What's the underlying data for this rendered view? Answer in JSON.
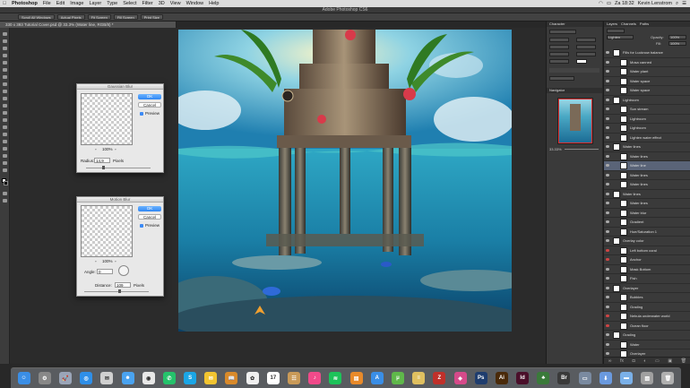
{
  "menubar": {
    "app": "Photoshop",
    "items": [
      "File",
      "Edit",
      "Image",
      "Layer",
      "Type",
      "Select",
      "Filter",
      "3D",
      "View",
      "Window",
      "Help"
    ],
    "clock": "Za 18:32",
    "user": "Kevin Lenstrom"
  },
  "window": {
    "title": "Adobe Photoshop CS6"
  },
  "options": {
    "buttons": [
      "Scroll All Windows",
      "Actual Pixels",
      "Fit Screen",
      "Fill Screen",
      "Print Size"
    ]
  },
  "document": {
    "tab": "330 x 393 Tutorial Cover.psd @ 33.3% (Water line, RGB/8) *"
  },
  "gaussian": {
    "title": "Gaussian Blur",
    "ok": "OK",
    "cancel": "Cancel",
    "preview": "Preview",
    "zoom": "100%",
    "radius_label": "Radius:",
    "radius_value": "14,9",
    "radius_unit": "Pixels"
  },
  "motion": {
    "title": "Motion Blur",
    "ok": "OK",
    "cancel": "Cancel",
    "preview": "Preview",
    "zoom": "100%",
    "angle_label": "Angle:",
    "angle_value": "0",
    "distance_label": "Distance:",
    "distance_value": "109",
    "distance_unit": "Pixels"
  },
  "dock_right": {
    "character_tab": "Character",
    "navigator_tab": "Navigator",
    "nav_zoom": "33.33%"
  },
  "layers_panel": {
    "tabs": [
      "Layers",
      "Channels",
      "Paths"
    ],
    "blend": "Lighten",
    "opacity_label": "Opacity:",
    "opacity": "100%",
    "fill_label": "Fill:",
    "fill": "100%",
    "layers": [
      {
        "name": "Fills for Lucknow balance",
        "sel": false,
        "red": false
      },
      {
        "name": "Mosa canned",
        "sel": false,
        "red": false
      },
      {
        "name": "Water plant",
        "sel": false,
        "red": false
      },
      {
        "name": "Water space",
        "sel": false,
        "red": false
      },
      {
        "name": "Water space",
        "sel": false,
        "red": false
      },
      {
        "name": "Lightroom",
        "sel": false,
        "red": false
      },
      {
        "name": "Sun stream",
        "sel": false,
        "red": false
      },
      {
        "name": "Lightroom",
        "sel": false,
        "red": false
      },
      {
        "name": "Lightroom",
        "sel": false,
        "red": false
      },
      {
        "name": "Lighten water effect",
        "sel": false,
        "red": false
      },
      {
        "name": "Water lines",
        "sel": false,
        "red": false
      },
      {
        "name": "Water lines",
        "sel": false,
        "red": false
      },
      {
        "name": "Water line",
        "sel": true,
        "red": false
      },
      {
        "name": "Water lines",
        "sel": false,
        "red": false
      },
      {
        "name": "Water lines",
        "sel": false,
        "red": false
      },
      {
        "name": "Water lines",
        "sel": false,
        "red": false
      },
      {
        "name": "Water lines",
        "sel": false,
        "red": false
      },
      {
        "name": "Water blur",
        "sel": false,
        "red": false
      },
      {
        "name": "Gradient",
        "sel": false,
        "red": false
      },
      {
        "name": "Hue/Saturation 1",
        "sel": false,
        "red": false
      },
      {
        "name": "Overlay color",
        "sel": false,
        "red": false
      },
      {
        "name": "Left bottom coral",
        "sel": false,
        "red": true
      },
      {
        "name": "Anchor",
        "sel": false,
        "red": true
      },
      {
        "name": "Mask Bottom",
        "sel": false,
        "red": false
      },
      {
        "name": "Fish",
        "sel": false,
        "red": false
      },
      {
        "name": "Overlayer",
        "sel": false,
        "red": false
      },
      {
        "name": "Bubbles",
        "sel": false,
        "red": false
      },
      {
        "name": "Grading",
        "sel": false,
        "red": false
      },
      {
        "name": "Nebula underwater world",
        "sel": false,
        "red": true
      },
      {
        "name": "Ocean floor",
        "sel": false,
        "red": true
      },
      {
        "name": "Grading",
        "sel": false,
        "red": false
      },
      {
        "name": "Water",
        "sel": false,
        "red": false
      },
      {
        "name": "Overlayer",
        "sel": false,
        "red": false
      }
    ]
  },
  "dock_apps": [
    {
      "name": "finder-icon",
      "color": "#3a8ee6",
      "glyph": "☺"
    },
    {
      "name": "system-preferences-icon",
      "color": "#888888",
      "glyph": "⚙"
    },
    {
      "name": "launchpad-icon",
      "color": "#9aa5b8",
      "glyph": "🚀"
    },
    {
      "name": "safari-icon",
      "color": "#2f8fe8",
      "glyph": "◎"
    },
    {
      "name": "mail-icon",
      "color": "#d0d0d0",
      "glyph": "✉"
    },
    {
      "name": "finder-icon-2",
      "color": "#4aa3f0",
      "glyph": "☻"
    },
    {
      "name": "chrome-icon",
      "color": "#e8e8e8",
      "glyph": "◉"
    },
    {
      "name": "whatsapp-icon",
      "color": "#25c26b",
      "glyph": "✆"
    },
    {
      "name": "skype-icon",
      "color": "#1ba6e6",
      "glyph": "S"
    },
    {
      "name": "mail-stamp-icon",
      "color": "#f2c430",
      "glyph": "✉"
    },
    {
      "name": "books-icon",
      "color": "#d98a2a",
      "glyph": "📖"
    },
    {
      "name": "photos-icon",
      "color": "#f0f0f0",
      "glyph": "✿"
    },
    {
      "name": "calendar-icon",
      "color": "#ffffff",
      "glyph": "17"
    },
    {
      "name": "contacts-icon",
      "color": "#c99a58",
      "glyph": "☷"
    },
    {
      "name": "itunes-icon",
      "color": "#f04a8a",
      "glyph": "♪"
    },
    {
      "name": "spotify-icon",
      "color": "#1dc35a",
      "glyph": "≋"
    },
    {
      "name": "preview-icon",
      "color": "#e88a2a",
      "glyph": "▤"
    },
    {
      "name": "app-store-icon",
      "color": "#3a8ee6",
      "glyph": "A"
    },
    {
      "name": "utorrent-icon",
      "color": "#5fb84a",
      "glyph": "μ"
    },
    {
      "name": "notes-icon",
      "color": "#e0c060",
      "glyph": "≡"
    },
    {
      "name": "filezilla-icon",
      "color": "#c0302a",
      "glyph": "Z"
    },
    {
      "name": "color-picker-icon",
      "color": "#d64a8a",
      "glyph": "◈"
    },
    {
      "name": "photoshop-icon",
      "color": "#1f3d6e",
      "glyph": "Ps"
    },
    {
      "name": "illustrator-icon",
      "color": "#4a2a0a",
      "glyph": "Ai"
    },
    {
      "name": "indesign-icon",
      "color": "#4a0f2a",
      "glyph": "Id"
    },
    {
      "name": "tree-icon",
      "color": "#3a7a3a",
      "glyph": "♣"
    },
    {
      "name": "bridge-icon",
      "color": "#3a3a3a",
      "glyph": "Br"
    },
    {
      "name": "finder-window-icon",
      "color": "#7a8aa0",
      "glyph": "▭"
    },
    {
      "name": "downloads-icon",
      "color": "#6a9adf",
      "glyph": "⬇"
    },
    {
      "name": "folder-icon",
      "color": "#7ab0e8",
      "glyph": "▬"
    },
    {
      "name": "screenshot-icon",
      "color": "#a0a0a0",
      "glyph": "▧"
    },
    {
      "name": "trash-icon",
      "color": "#b0b0b0",
      "glyph": "🗑"
    }
  ]
}
